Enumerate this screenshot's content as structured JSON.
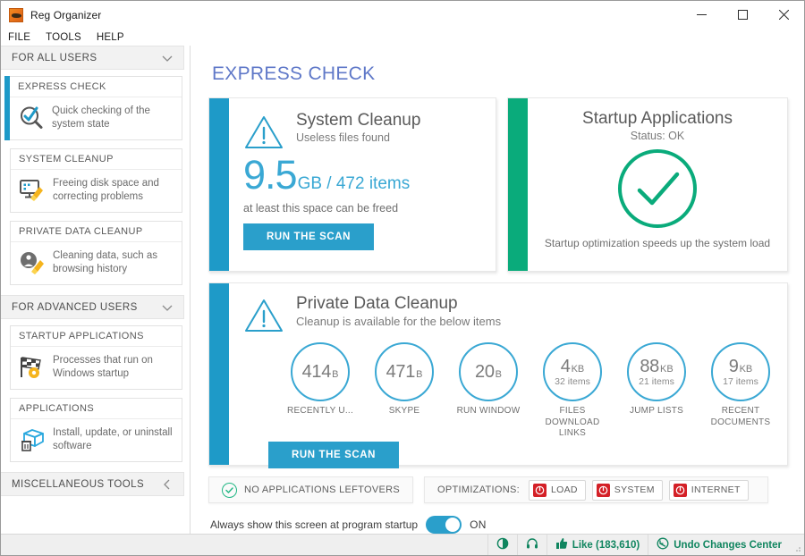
{
  "window": {
    "title": "Reg Organizer",
    "app_icon": "reg-organizer-icon",
    "controls": {
      "minimize": "minimize-icon",
      "maximize": "maximize-icon",
      "close": "close-icon"
    }
  },
  "menu": {
    "items": [
      "FILE",
      "TOOLS",
      "HELP"
    ]
  },
  "sidebar": {
    "groups": [
      {
        "label": "FOR ALL USERS",
        "chevron": "chevron-down-icon",
        "items": [
          {
            "title": "EXPRESS CHECK",
            "desc": "Quick checking of the system state",
            "icon": "magnifier-check-icon",
            "active": true
          },
          {
            "title": "SYSTEM CLEANUP",
            "desc": "Freeing disk space and correcting problems",
            "icon": "monitor-broom-icon",
            "active": false
          },
          {
            "title": "PRIVATE DATA CLEANUP",
            "desc": "Cleaning data, such as browsing history",
            "icon": "user-broom-icon",
            "active": false
          }
        ]
      },
      {
        "label": "FOR ADVANCED USERS",
        "chevron": "chevron-down-icon",
        "items": [
          {
            "title": "STARTUP APPLICATIONS",
            "desc": "Processes that run on Windows startup",
            "icon": "checkered-flag-gear-icon",
            "active": false
          },
          {
            "title": "APPLICATIONS",
            "desc": "Install, update, or uninstall software",
            "icon": "box-trash-icon",
            "active": false
          }
        ]
      },
      {
        "label": "MISCELLANEOUS TOOLS",
        "chevron": "chevron-left-icon",
        "items": []
      }
    ]
  },
  "main": {
    "page_title": "EXPRESS CHECK",
    "system_cleanup": {
      "accent": "#1e9ac8",
      "icon": "warning-triangle-icon",
      "title": "System Cleanup",
      "subtitle": "Useless files found",
      "value": "9.5",
      "unit": "GB / 472 items",
      "note": "at least this space can be freed",
      "button": "RUN THE SCAN"
    },
    "startup_applications": {
      "accent": "#0aab7b",
      "title": "Startup Applications",
      "status": "Status: OK",
      "icon": "check-circle-icon",
      "footer": "Startup optimization speeds up the system load"
    },
    "private_data_cleanup": {
      "accent": "#1e9ac8",
      "icon": "warning-triangle-icon",
      "title": "Private Data Cleanup",
      "subtitle": "Cleanup is available for the below items",
      "button": "RUN THE SCAN",
      "circles": [
        {
          "num": "414",
          "unit": "B",
          "items": "",
          "label": "RECENTLY U..."
        },
        {
          "num": "471",
          "unit": "B",
          "items": "",
          "label": "SKYPE"
        },
        {
          "num": "20",
          "unit": "B",
          "items": "",
          "label": "RUN WINDOW"
        },
        {
          "num": "4",
          "unit": "KB",
          "items": "32 items",
          "label": "FILES DOWNLOAD LINKS"
        },
        {
          "num": "88",
          "unit": "KB",
          "items": "21 items",
          "label": "JUMP LISTS"
        },
        {
          "num": "9",
          "unit": "KB",
          "items": "17 items",
          "label": "RECENT DOCUMENTS"
        }
      ]
    },
    "leftovers_pill": {
      "icon": "check-circle-icon",
      "label": "NO APPLICATIONS LEFTOVERS"
    },
    "optimizations": {
      "label": "OPTIMIZATIONS:",
      "buttons": [
        {
          "label": "LOAD",
          "icon": "power-icon",
          "color": "#d42027"
        },
        {
          "label": "SYSTEM",
          "icon": "power-icon",
          "color": "#d42027"
        },
        {
          "label": "INTERNET",
          "icon": "power-icon",
          "color": "#d42027"
        }
      ]
    },
    "startup_toggle": {
      "label": "Always show this screen at program startup",
      "state": "ON",
      "on": true
    }
  },
  "statusbar": {
    "items": [
      {
        "icon": "contrast-icon",
        "label": ""
      },
      {
        "icon": "headphones-icon",
        "label": ""
      },
      {
        "icon": "thumbs-up-icon",
        "label": "Like (183,610)"
      },
      {
        "icon": "undo-circle-icon",
        "label": "Undo Changes Center"
      }
    ]
  }
}
